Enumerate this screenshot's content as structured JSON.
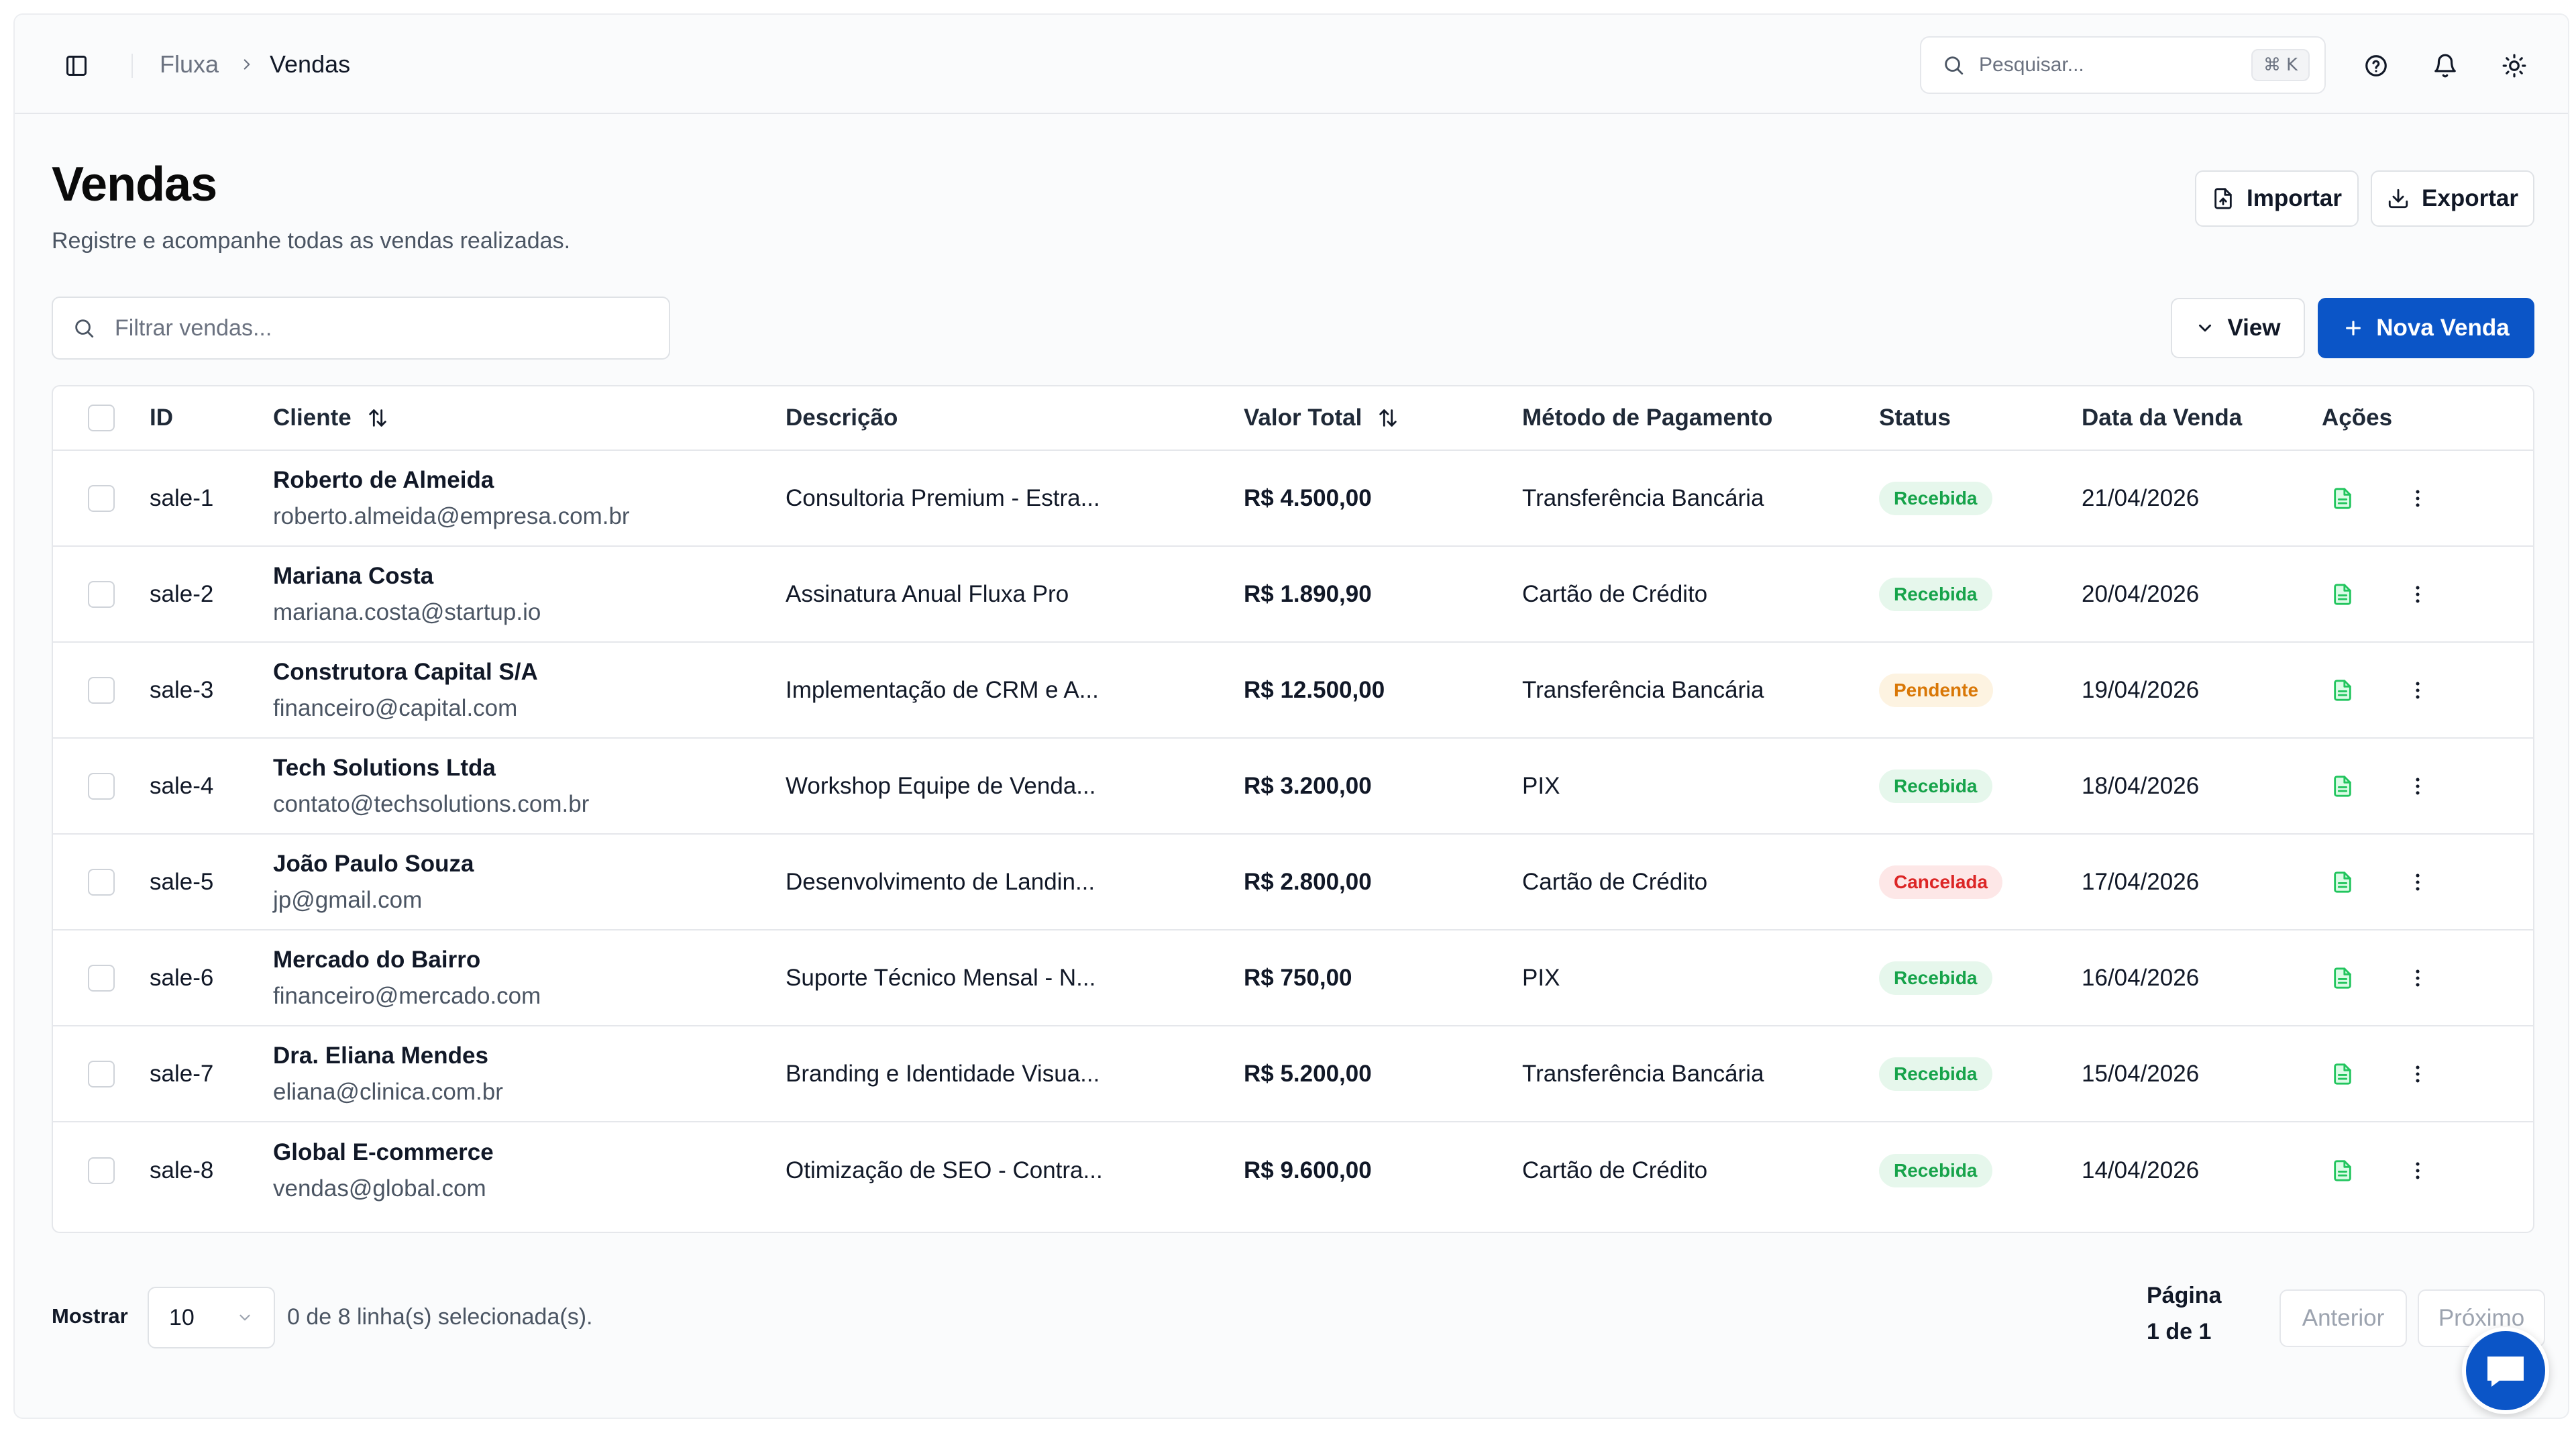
{
  "breadcrumb": {
    "root": "Fluxa",
    "current": "Vendas"
  },
  "search": {
    "placeholder": "Pesquisar...",
    "shortcut_symbol": "⌘",
    "shortcut_key": "K"
  },
  "header": {
    "title": "Vendas",
    "subtitle": "Registre e acompanhe todas as vendas realizadas.",
    "import_label": "Importar",
    "export_label": "Exportar"
  },
  "toolbar": {
    "filter_placeholder": "Filtrar vendas...",
    "view_label": "View",
    "new_label": "Nova Venda"
  },
  "table": {
    "columns": {
      "id": "ID",
      "client": "Cliente",
      "description": "Descrição",
      "total": "Valor Total",
      "payment": "Método de Pagamento",
      "status": "Status",
      "date": "Data da Venda",
      "actions": "Ações"
    },
    "rows": [
      {
        "id": "sale-1",
        "name": "Roberto de Almeida",
        "email": "roberto.almeida@empresa.com.br",
        "description": "Consultoria Premium - Estra...",
        "total": "R$ 4.500,00",
        "payment": "Transferência Bancária",
        "status": "Recebida",
        "status_type": "ok",
        "date": "21/04/2026"
      },
      {
        "id": "sale-2",
        "name": "Mariana Costa",
        "email": "mariana.costa@startup.io",
        "description": "Assinatura Anual Fluxa Pro",
        "total": "R$ 1.890,90",
        "payment": "Cartão de Crédito",
        "status": "Recebida",
        "status_type": "ok",
        "date": "20/04/2026"
      },
      {
        "id": "sale-3",
        "name": "Construtora Capital S/A",
        "email": "financeiro@capital.com",
        "description": "Implementação de CRM e A...",
        "total": "R$ 12.500,00",
        "payment": "Transferência Bancária",
        "status": "Pendente",
        "status_type": "pend",
        "date": "19/04/2026"
      },
      {
        "id": "sale-4",
        "name": "Tech Solutions Ltda",
        "email": "contato@techsolutions.com.br",
        "description": "Workshop Equipe de Venda...",
        "total": "R$ 3.200,00",
        "payment": "PIX",
        "status": "Recebida",
        "status_type": "ok",
        "date": "18/04/2026"
      },
      {
        "id": "sale-5",
        "name": "João Paulo Souza",
        "email": "jp@gmail.com",
        "description": "Desenvolvimento de Landin...",
        "total": "R$ 2.800,00",
        "payment": "Cartão de Crédito",
        "status": "Cancelada",
        "status_type": "canc",
        "date": "17/04/2026"
      },
      {
        "id": "sale-6",
        "name": "Mercado do Bairro",
        "email": "financeiro@mercado.com",
        "description": "Suporte Técnico Mensal - N...",
        "total": "R$ 750,00",
        "payment": "PIX",
        "status": "Recebida",
        "status_type": "ok",
        "date": "16/04/2026"
      },
      {
        "id": "sale-7",
        "name": "Dra. Eliana Mendes",
        "email": "eliana@clinica.com.br",
        "description": "Branding e Identidade Visua...",
        "total": "R$ 5.200,00",
        "payment": "Transferência Bancária",
        "status": "Recebida",
        "status_type": "ok",
        "date": "15/04/2026"
      },
      {
        "id": "sale-8",
        "name": "Global E-commerce",
        "email": "vendas@global.com",
        "description": "Otimização de SEO - Contra...",
        "total": "R$ 9.600,00",
        "payment": "Cartão de Crédito",
        "status": "Recebida",
        "status_type": "ok",
        "date": "14/04/2026"
      }
    ]
  },
  "footer": {
    "show_label": "Mostrar",
    "per_page": "10",
    "selection_info": "0 de 8 linha(s) selecionada(s).",
    "page_label": "Página",
    "page_value": "1 de 1",
    "prev_label": "Anterior",
    "next_label": "Próximo"
  },
  "colors": {
    "primary": "#0b55c7",
    "received": "#16a34a",
    "pending": "#d97706",
    "cancelled": "#dc2626"
  },
  "icons": [
    "sidebar-toggle-icon",
    "chevron-right-icon",
    "search-icon",
    "help-icon",
    "bell-icon",
    "sun-icon",
    "file-upload-icon",
    "download-icon",
    "chevron-down-icon",
    "plus-icon",
    "sort-icon",
    "document-icon",
    "more-vertical-icon",
    "chat-icon"
  ]
}
